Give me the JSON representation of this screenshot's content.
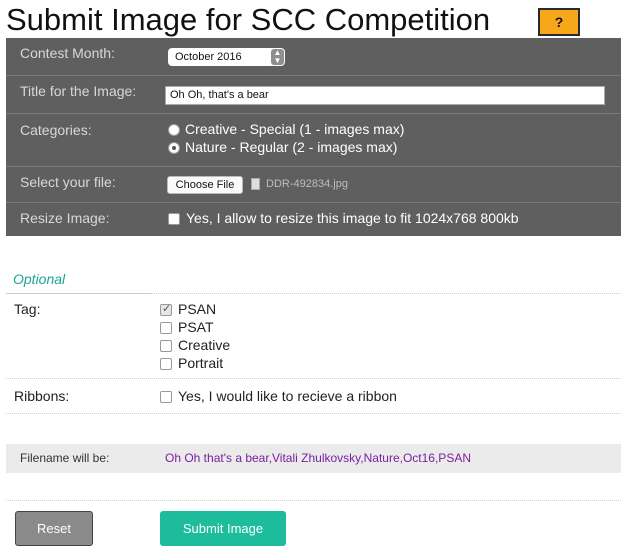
{
  "page_title": "Submit Image for SCC Competition",
  "help_button": "?",
  "form": {
    "contest_month": {
      "label": "Contest Month:",
      "value": "October 2016"
    },
    "title": {
      "label": "Title for the Image:",
      "value": "Oh Oh, that's a bear"
    },
    "categories": {
      "label": "Categories:",
      "options": [
        {
          "label": "Creative - Special (1 - images max)",
          "selected": false
        },
        {
          "label": "Nature - Regular (2 - images max)",
          "selected": true
        }
      ]
    },
    "file": {
      "label": "Select your file:",
      "button": "Choose File",
      "filename": "DDR-492834.jpg"
    },
    "resize": {
      "label": "Resize Image:",
      "text": "Yes, I allow to resize this image to fit 1024x768 800kb",
      "checked": false
    }
  },
  "optional": {
    "heading": "Optional",
    "tag": {
      "label": "Tag:",
      "options": [
        {
          "label": "PSAN",
          "checked": true
        },
        {
          "label": "PSAT",
          "checked": false
        },
        {
          "label": "Creative",
          "checked": false
        },
        {
          "label": "Portrait",
          "checked": false
        }
      ]
    },
    "ribbons": {
      "label": "Ribbons:",
      "text": "Yes, I would like to recieve a ribbon",
      "checked": false
    }
  },
  "filename_preview": {
    "label": "Filename will be:",
    "value": "Oh Oh that's a bear,Vitali Zhulkovsky,Nature,Oct16,PSAN"
  },
  "buttons": {
    "reset": "Reset",
    "submit": "Submit Image"
  },
  "colors": {
    "accent": "#1cbc9c",
    "help": "#f6a81a",
    "panel": "#5f5f5f",
    "filename": "#7a1fa0",
    "optional": "#1aa594"
  }
}
